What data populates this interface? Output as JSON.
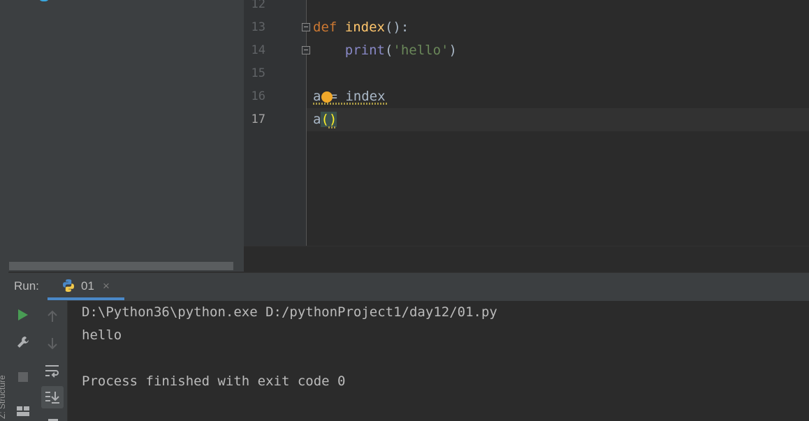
{
  "editor": {
    "lines": [
      {
        "num": "12"
      },
      {
        "num": "13",
        "kw": "def",
        "fn": "index",
        "punct": "():"
      },
      {
        "num": "14",
        "indent": "    ",
        "builtin": "print",
        "open": "(",
        "str": "'hello'",
        "close": ")"
      },
      {
        "num": "15"
      },
      {
        "num": "16",
        "text_a": "a",
        "text_eq": "= index"
      },
      {
        "num": "17",
        "text_a": "a",
        "brackets": "()"
      }
    ]
  },
  "run": {
    "label": "Run:",
    "tab_label": "01",
    "close_glyph": "×"
  },
  "console": {
    "command": "D:\\Python36\\python.exe D:/pythonProject1/day12/01.py",
    "output": "hello",
    "exit_message": "Process finished with exit code 0"
  },
  "side_panel": {
    "label": "Z: Structure"
  },
  "colors": {
    "keyword": "#cc7832",
    "function": "#ffc66d",
    "builtin": "#8888c6",
    "string": "#6a8759",
    "run_green": "#499c54",
    "accent": "#4a88c7"
  },
  "icons": [
    "run-icon",
    "wrench-icon",
    "stop-icon",
    "layout-icon",
    "up-arrow-icon",
    "down-arrow-icon",
    "soft-wrap-icon",
    "scroll-to-end-icon",
    "python-icon",
    "close-icon",
    "bulb-icon"
  ]
}
